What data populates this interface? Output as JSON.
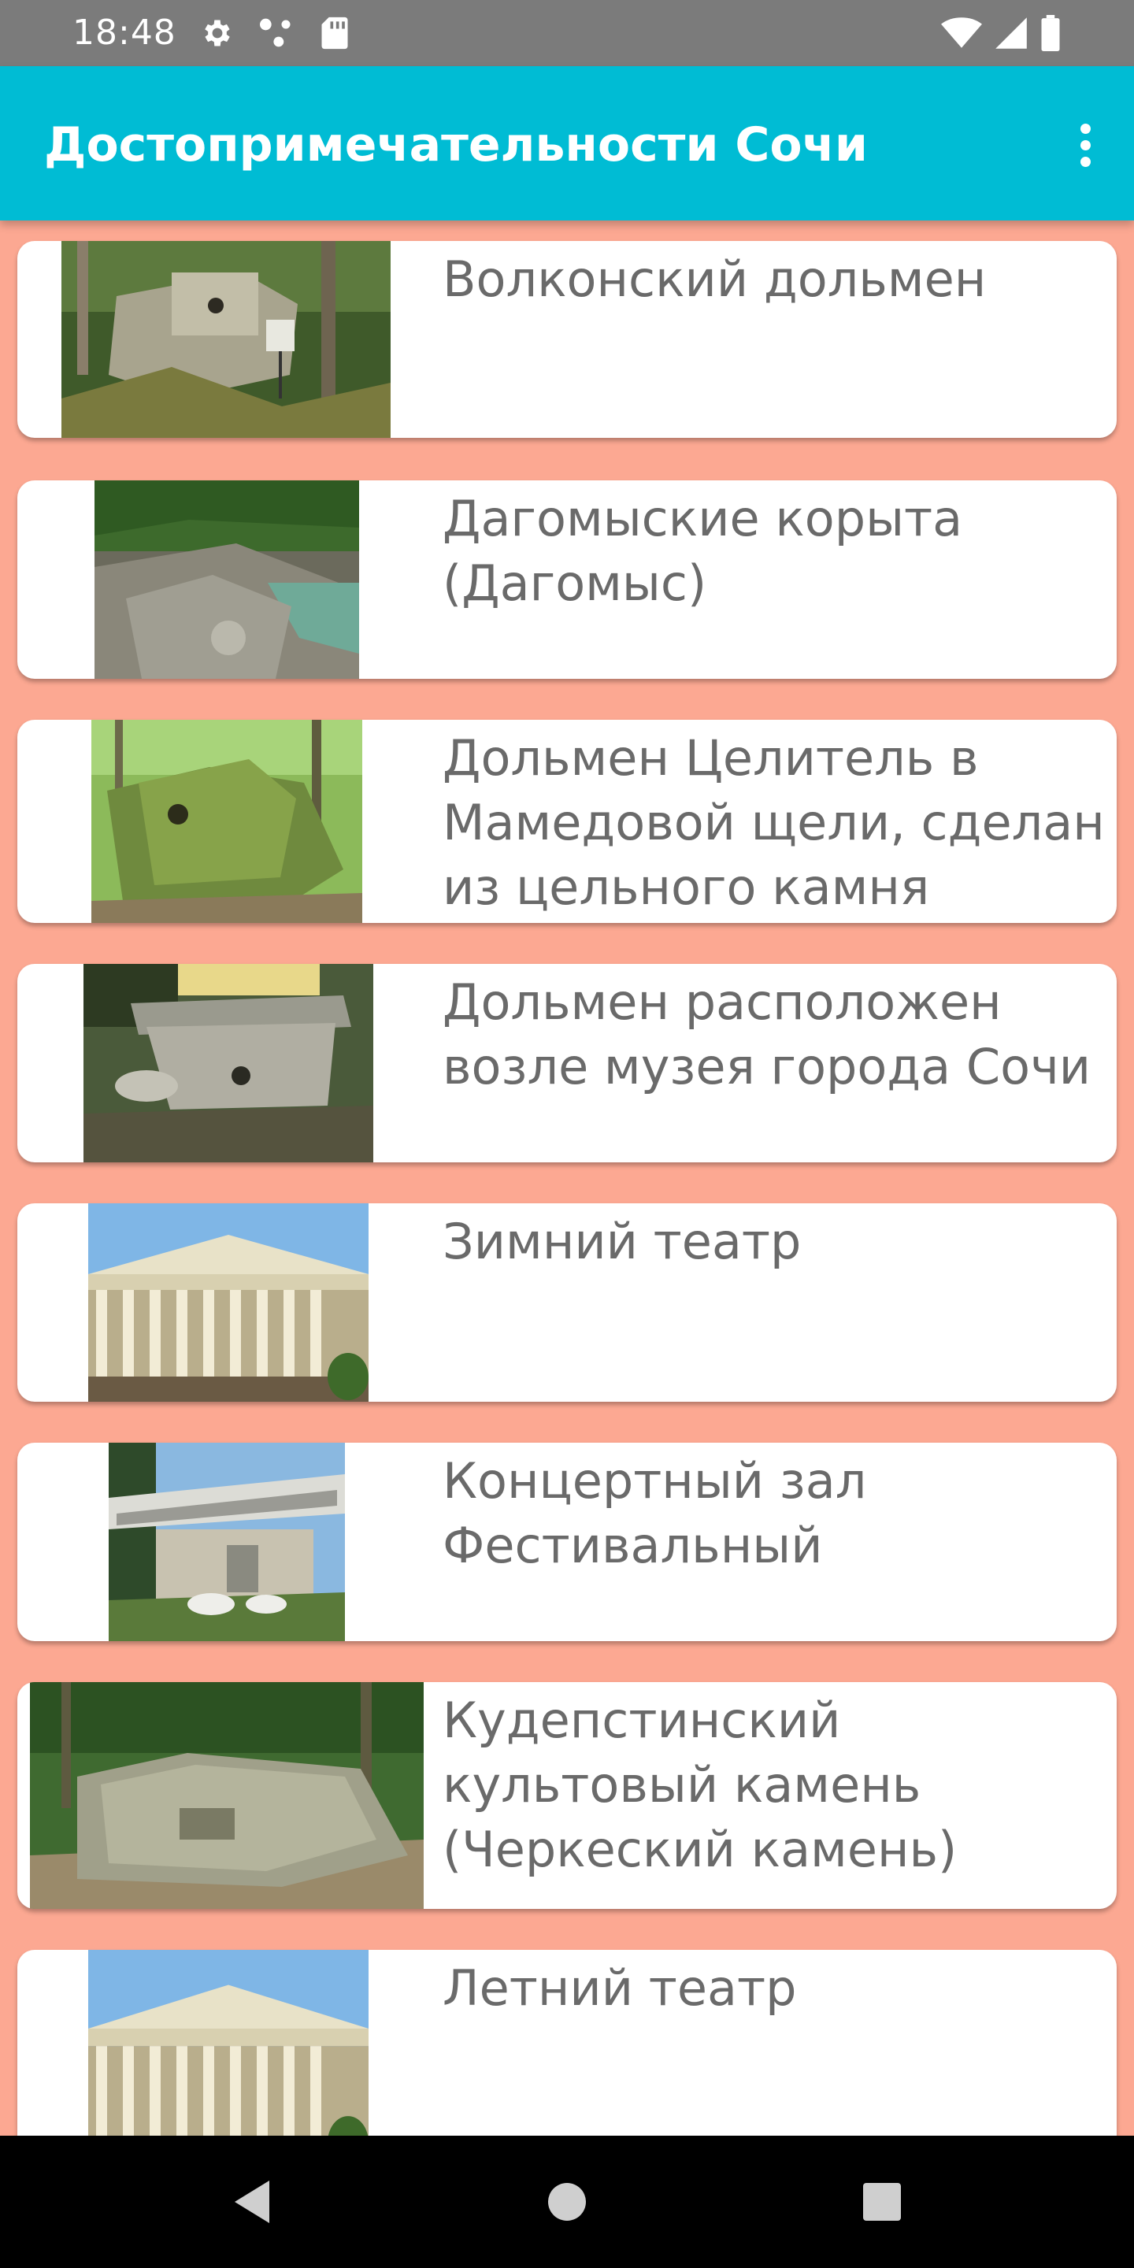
{
  "status_bar": {
    "time": "18:48",
    "left_icons": [
      "gear-icon",
      "nodes-icon",
      "sd-card-icon"
    ],
    "right_icons": [
      "wifi-icon",
      "signal-icon",
      "battery-icon"
    ]
  },
  "app_bar": {
    "title": "Достопримечательности Сочи",
    "color": "#00bcd4",
    "menu_icon": "more-vert-icon"
  },
  "list_background": "#fca892",
  "items": [
    {
      "title": "Волконский дольмен",
      "image": "dolmen-forest-photo"
    },
    {
      "title": "Дагомыские корыта (Дагомыс)",
      "image": "river-rocks-photo"
    },
    {
      "title": "Дольмен Целитель в Мамедовой щели, сделан из цельного камня",
      "image": "mossy-dolmen-photo"
    },
    {
      "title": "Дольмен расположен возле музея города Сочи",
      "image": "museum-dolmen-photo"
    },
    {
      "title": "Зимний театр",
      "image": "theatre-columns-photo"
    },
    {
      "title": "Концертный зал Фестивальный",
      "image": "concert-hall-photo"
    },
    {
      "title": "Кудепстинский культовый камень (Черкеский камень)",
      "image": "cult-stone-photo"
    },
    {
      "title": "Летний театр",
      "image": "theatre-columns-photo"
    }
  ],
  "nav_bar": {
    "icons": [
      "back-triangle-icon",
      "home-circle-icon",
      "recents-square-icon"
    ]
  }
}
